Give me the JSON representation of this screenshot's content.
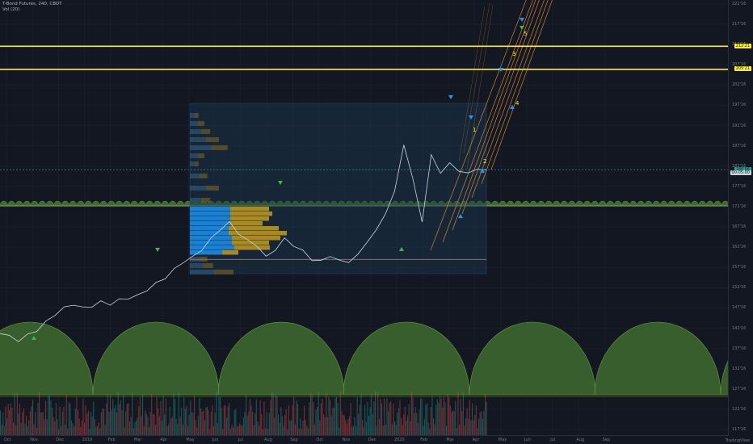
{
  "legend": {
    "title": "T-Bond Futures, 240, CBOT",
    "vol": "Vol (20)"
  },
  "price_axis": {
    "ticks": [
      "222'16",
      "217'16",
      "212'16",
      "207'16",
      "202'16",
      "197'16",
      "192'16",
      "187'16",
      "182'16",
      "177'16",
      "172'16",
      "167'16",
      "162'16",
      "157'16",
      "152'16",
      "147'16",
      "142'16",
      "137'16",
      "132'16",
      "127'16",
      "122'16",
      "117'16"
    ],
    "tags": [
      {
        "text": "212'21",
        "color": "#ffeb3b",
        "price": 211.0
      },
      {
        "text": "205'21",
        "color": "#ffeb3b",
        "price": 205.3
      },
      {
        "text": "180'06",
        "color": "#26a69a",
        "price": 180.6
      },
      {
        "text": "00:05:00",
        "color": "#d1d4dc",
        "price": 179.8
      }
    ]
  },
  "time_axis": {
    "labels": [
      "Oct",
      "Nov",
      "Dec",
      "2019",
      "Feb",
      "Mar",
      "Apr",
      "May",
      "Jun",
      "Jul",
      "Aug",
      "Sep",
      "Oct",
      "Nov",
      "Dec",
      "2020",
      "Feb",
      "Mar",
      "Apr",
      "May",
      "Jun",
      "Jul",
      "Aug",
      "Sep"
    ]
  },
  "footer": {
    "brand": "TradingView"
  },
  "chart_data": {
    "type": "line",
    "title": "T-Bond Futures, 240, CBOT",
    "ylim": [
      115,
      222
    ],
    "y_tick_labels": [
      "222'16",
      "217'16",
      "212'16",
      "207'16",
      "202'16",
      "197'16",
      "192'16",
      "187'16",
      "182'16",
      "177'16",
      "172'16",
      "167'16",
      "162'16",
      "157'16",
      "152'16",
      "147'16",
      "142'16",
      "137'16",
      "132'16",
      "127'16",
      "122'16",
      "117'16"
    ],
    "x_tick_labels": [
      "Oct",
      "Nov",
      "Dec",
      "2019",
      "Feb",
      "Mar",
      "Apr",
      "May",
      "Jun",
      "Jul",
      "Aug",
      "Sep",
      "Oct",
      "Nov",
      "Dec",
      "2020",
      "Feb",
      "Mar",
      "Apr",
      "May",
      "Jun",
      "Jul",
      "Aug",
      "Sep"
    ],
    "series": [
      {
        "values": [
          140.5,
          139.5,
          138.5,
          139.8,
          141.0,
          143.0,
          145.0,
          146.5,
          147.5,
          146.5,
          147.0,
          148.0,
          147.5,
          148.5,
          149.0,
          149.5,
          151.0,
          152.5,
          154.0,
          156.0,
          158.0,
          159.0,
          161.0,
          163.5,
          166.0,
          167.5,
          165.0,
          163.0,
          162.0,
          159.0,
          161.0,
          163.5,
          162.0,
          160.5,
          158.5,
          158.0,
          159.5,
          158.0,
          158.0,
          159.5,
          163.0,
          165.5,
          170.0,
          175.0,
          187.0,
          178.0,
          168.0,
          184.0,
          180.0,
          182.0,
          180.5,
          179.5,
          181.0,
          180.2
        ]
      }
    ],
    "horizontal_lines": [
      {
        "price": 211.0,
        "color": "#ffeb3b"
      },
      {
        "price": 205.3,
        "color": "#ffeb3b"
      },
      {
        "price": 180.6,
        "color": "#26a69a"
      },
      {
        "price": 158.5,
        "color": "#ef5350"
      }
    ],
    "wave_labels": [
      "1",
      "2",
      "3",
      "4",
      "5"
    ]
  }
}
